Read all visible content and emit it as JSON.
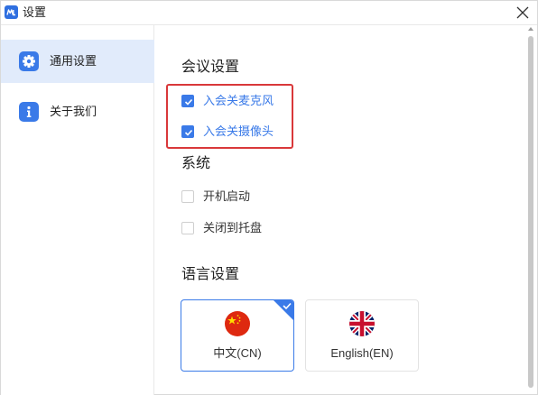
{
  "window": {
    "title": "设置"
  },
  "sidebar": {
    "items": [
      {
        "label": "通用设置",
        "icon": "gear-icon",
        "active": true
      },
      {
        "label": "关于我们",
        "icon": "info-icon",
        "active": false
      }
    ]
  },
  "sections": {
    "meeting": {
      "title": "会议设置",
      "options": [
        {
          "label": "入会关麦克风",
          "checked": true
        },
        {
          "label": "入会关摄像头",
          "checked": true
        }
      ]
    },
    "system": {
      "title": "系统",
      "options": [
        {
          "label": "开机启动",
          "checked": false
        },
        {
          "label": "关闭到托盘",
          "checked": false
        }
      ]
    },
    "language": {
      "title": "语言设置",
      "options": [
        {
          "label": "中文(CN)",
          "selected": true,
          "icon": "china-flag-icon"
        },
        {
          "label": "English(EN)",
          "selected": false,
          "icon": "uk-flag-icon"
        }
      ]
    }
  },
  "colors": {
    "accent": "#3a7ae8",
    "active_nav_bg": "#e1ebfb",
    "highlight_border": "#d9383a"
  }
}
